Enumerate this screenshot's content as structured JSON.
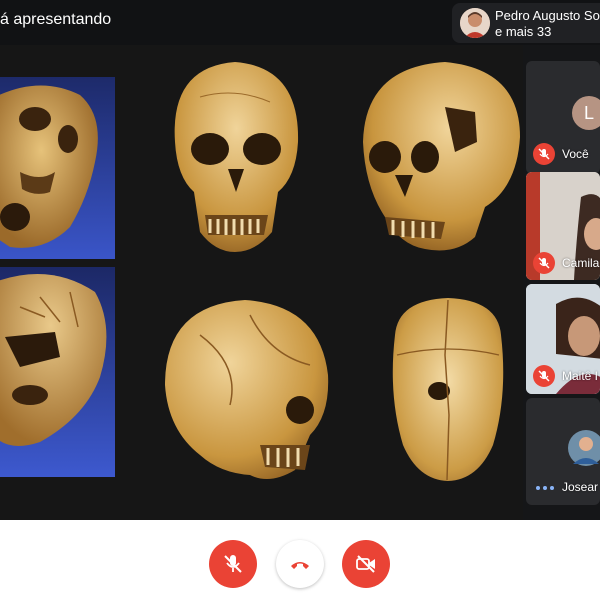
{
  "header": {
    "presenting_text": "á apresentando",
    "presenter_name": "Pedro Augusto So",
    "others_count": "e mais 33"
  },
  "participants": [
    {
      "name": "Você",
      "avatar_letter": "L",
      "muted": true
    },
    {
      "name": "Camila",
      "muted": true
    },
    {
      "name": "Maitê I",
      "muted": true
    },
    {
      "name": "Josear",
      "speaking_indicator": "dots-icon"
    }
  ],
  "controls": {
    "mic": "mic-off-icon",
    "hangup": "hangup-icon",
    "camera": "camera-off-icon"
  },
  "colors": {
    "topbar": "#111214",
    "stage": "#161616",
    "accent_red": "#ea4335",
    "avatar_bg": "#b69483",
    "speaking_dots": "#8ab4f8"
  },
  "presentation": {
    "content": "skull-photographs",
    "panels": [
      "skull-left-top",
      "skull-left-bottom",
      "skull-front",
      "skull-oblique",
      "skull-side",
      "skull-top"
    ]
  }
}
